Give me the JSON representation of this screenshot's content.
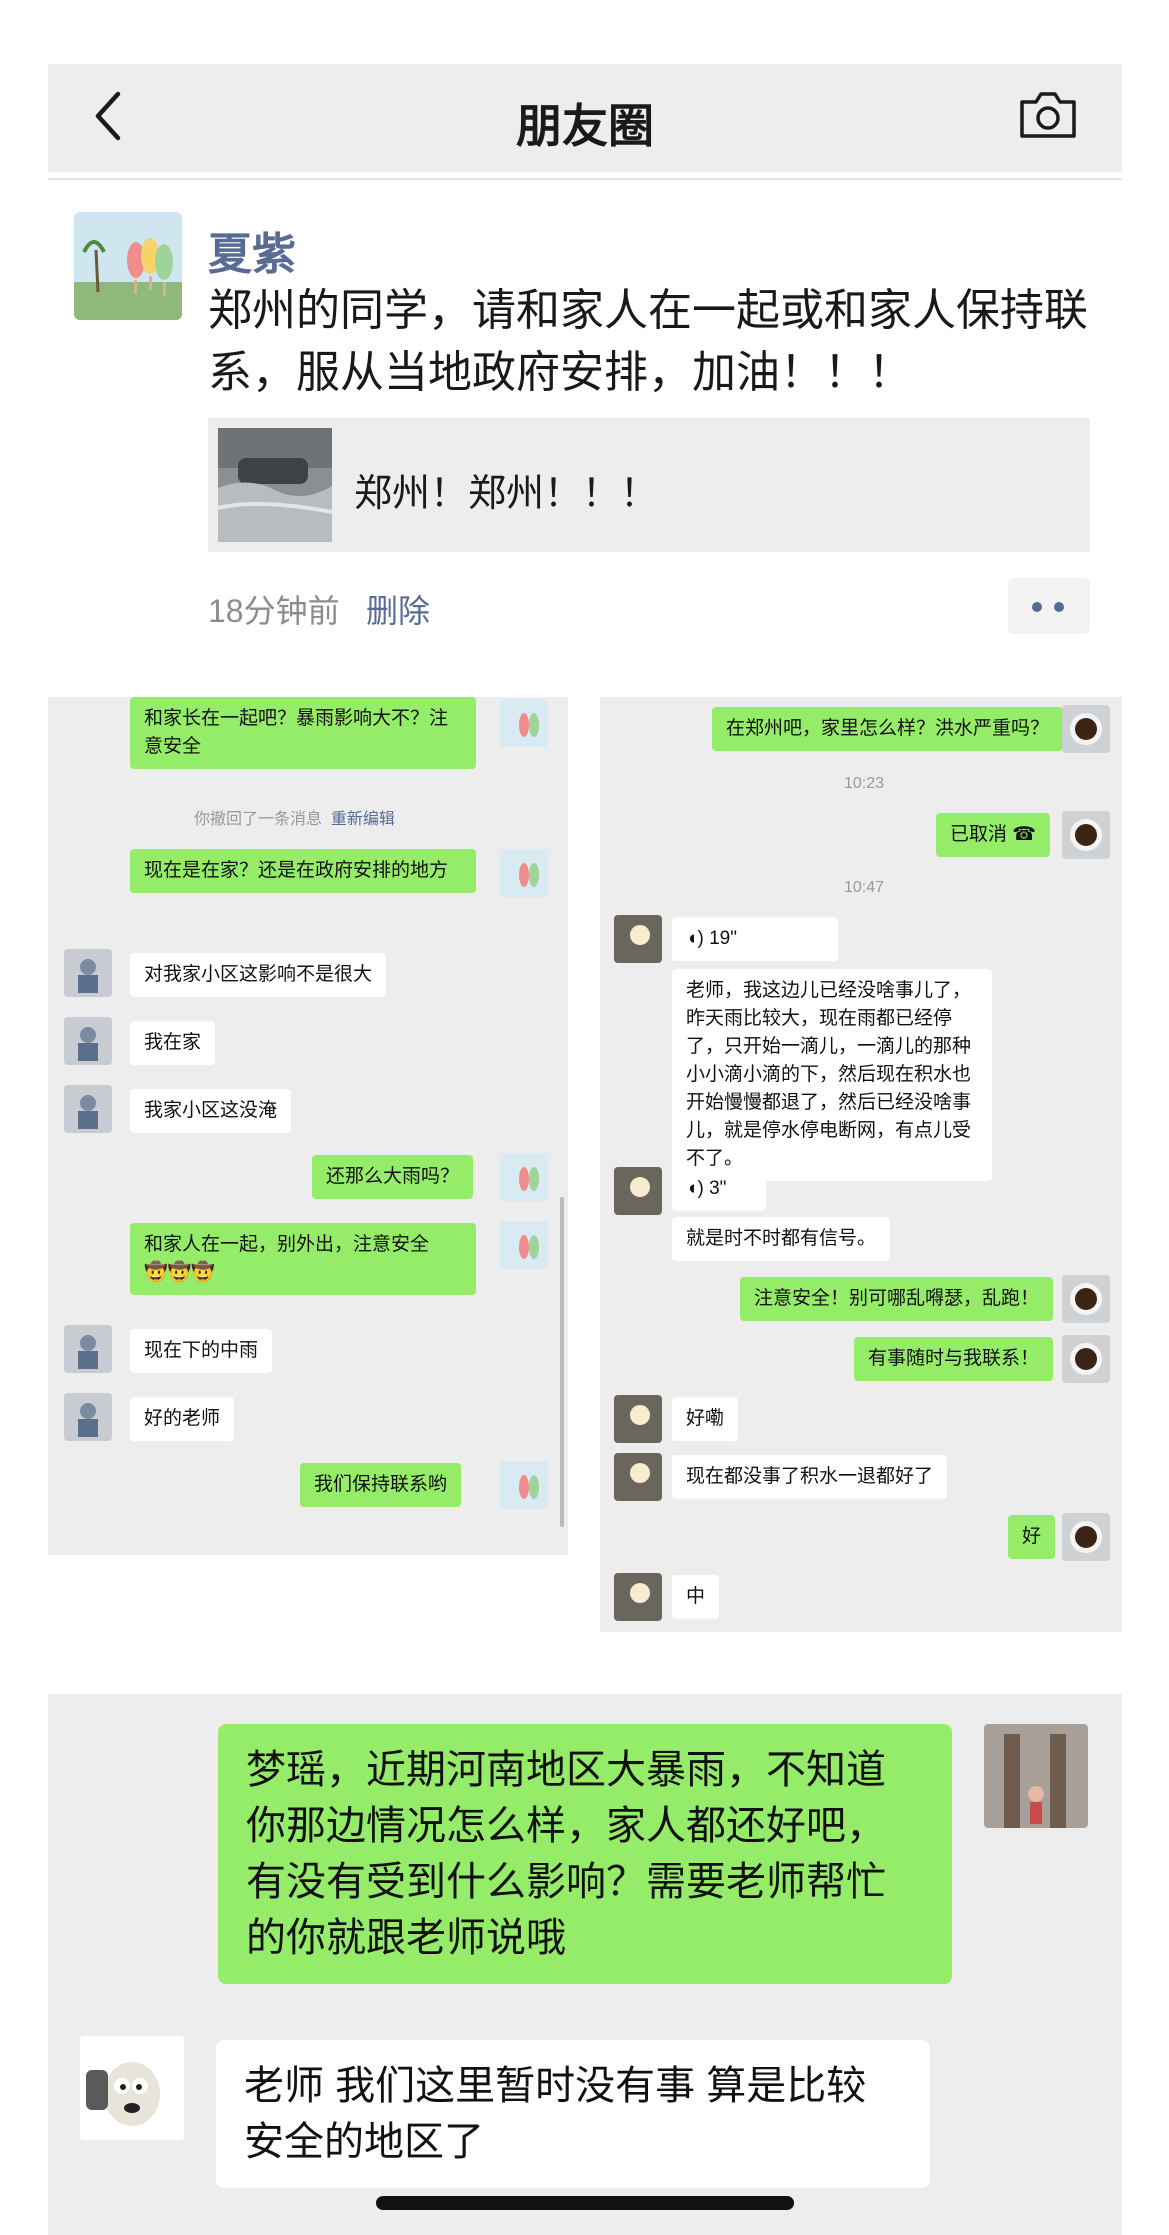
{
  "header": {
    "title": "朋友圈",
    "back_icon": "chevron-left-icon",
    "camera_icon": "camera-icon"
  },
  "post": {
    "author": "夏紫",
    "text": "郑州的同学，请和家人在一起或和家人保持联系，服从当地政府安排，加油！！！",
    "link_title": "郑州！郑州！！！",
    "time": "18分钟前",
    "delete_label": "删除"
  },
  "chat_left": {
    "recall_notice": "你撤回了一条消息",
    "reedit_label": "重新编辑",
    "messages": [
      {
        "side": "right",
        "text": "和家长在一起吧？暴雨影响大不？注意安全"
      },
      {
        "side": "right",
        "text": "现在是在家？还是在政府安排的地方"
      },
      {
        "side": "left",
        "text": "对我家小区这影响不是很大"
      },
      {
        "side": "left",
        "text": "我在家"
      },
      {
        "side": "left",
        "text": "我家小区这没淹"
      },
      {
        "side": "right",
        "text": "还那么大雨吗？"
      },
      {
        "side": "right",
        "text": "和家人在一起，别外出，注意安全"
      },
      {
        "side": "left",
        "text": "现在下的中雨"
      },
      {
        "side": "left",
        "text": "好的老师"
      },
      {
        "side": "right",
        "text": "我们保持联系哟"
      }
    ],
    "emoji": "🤠🤠🤠"
  },
  "chat_right": {
    "time_1": "10:23",
    "time_2": "10:47",
    "messages": [
      {
        "side": "right",
        "text": "在郑州吧，家里怎么样？洪水严重吗？"
      },
      {
        "side": "right",
        "text": "已取消"
      },
      {
        "side": "left",
        "text": "19\""
      },
      {
        "side": "left",
        "text": "老师，我这边儿已经没啥事儿了，昨天雨比较大，现在雨都已经停了，只开始一滴儿，一滴儿的那种小小滴小滴的下，然后现在积水也开始慢慢都退了，然后已经没啥事儿，就是停水停电断网，有点儿受不了。"
      },
      {
        "side": "left",
        "text": "3\""
      },
      {
        "side": "left",
        "text": "就是时不时都有信号。"
      },
      {
        "side": "right",
        "text": "注意安全！别可哪乱嘚瑟，乱跑！"
      },
      {
        "side": "right",
        "text": "有事随时与我联系！"
      },
      {
        "side": "left",
        "text": "好嘞"
      },
      {
        "side": "left",
        "text": "现在都没事了积水一退都好了"
      },
      {
        "side": "right",
        "text": "好"
      },
      {
        "side": "left",
        "text": "中"
      }
    ]
  },
  "chat_bottom": {
    "messages": [
      {
        "side": "right",
        "text": "梦瑶，近期河南地区大暴雨，不知道你那边情况怎么样，家人都还好吧，有没有受到什么影响？需要老师帮忙的你就跟老师说哦"
      },
      {
        "side": "left",
        "text": "老师 我们这里暂时没有事 算是比较安全的地区了"
      }
    ]
  },
  "colors": {
    "green_bubble": "#95ec69",
    "link_blue": "#576b95",
    "panel_bg": "#ededed"
  }
}
